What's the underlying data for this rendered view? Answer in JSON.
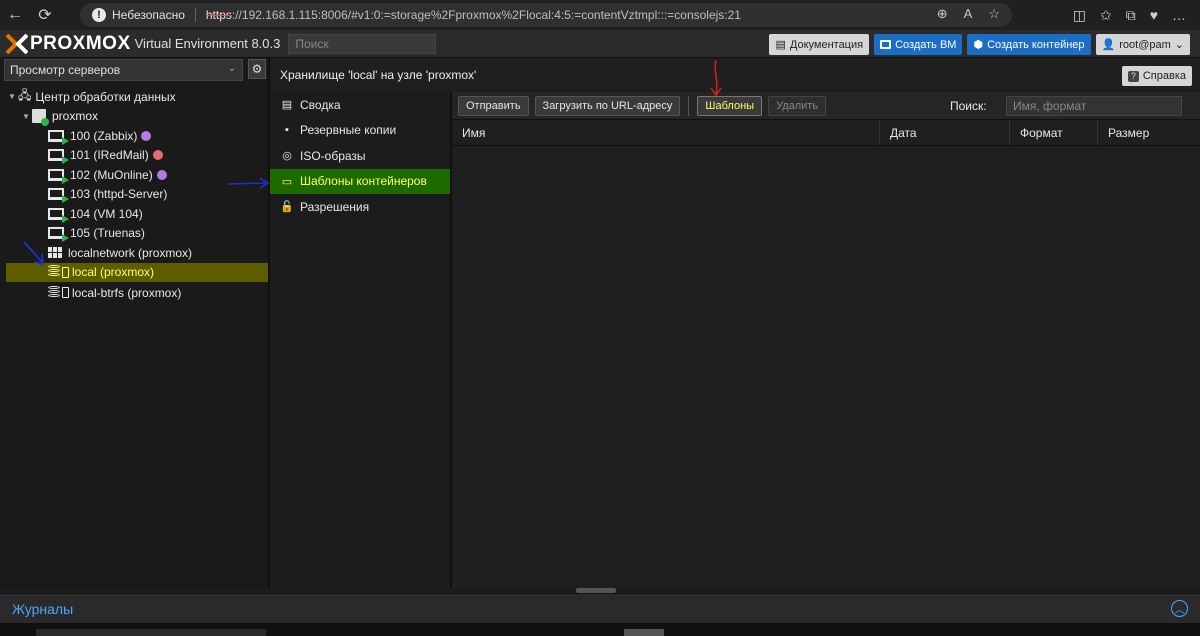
{
  "browser": {
    "insecure_label": "Небезопасно",
    "url_scheme": "https",
    "url_rest": "://192.168.1.115:8006/#v1:0:=storage%2Fproxmox%2Flocal:4:5:=contentVztmpl:::=consolejs:21"
  },
  "header": {
    "logo_text": "PROXMOX",
    "version": "Virtual Environment 8.0.3",
    "search_placeholder": "Поиск",
    "doc_button": "Документация",
    "create_vm_button": "Создать ВМ",
    "create_ct_button": "Создать контейнер",
    "user_button": "root@pam"
  },
  "left": {
    "view_select": "Просмотр серверов",
    "tree": {
      "datacenter": "Центр обработки данных",
      "node": "proxmox",
      "vms": [
        {
          "label": "100 (Zabbix)",
          "tag_color": "#b57ae0"
        },
        {
          "label": "101 (IRedMail)",
          "tag_color": "#e07070"
        },
        {
          "label": "102 (MuOnline)",
          "tag_color": "#b57ae0"
        },
        {
          "label": "103 (httpd-Server)",
          "tag_color": ""
        },
        {
          "label": "104 (VM 104)",
          "tag_color": ""
        },
        {
          "label": "105 (Truenas)",
          "tag_color": ""
        }
      ],
      "network": "localnetwork (proxmox)",
      "storage_local": "local (proxmox)",
      "storage_btrfs": "local-btrfs (proxmox)"
    }
  },
  "content": {
    "title": "Хранилище 'local' на узле 'proxmox'",
    "help_button": "Справка",
    "menu": [
      {
        "label": "Сводка",
        "icon": "book-icon"
      },
      {
        "label": "Резервные копии",
        "icon": "floppy-icon"
      },
      {
        "label": "ISO-образы",
        "icon": "disc-icon"
      },
      {
        "label": "Шаблоны контейнеров",
        "icon": "folder-icon"
      },
      {
        "label": "Разрешения",
        "icon": "unlock-icon"
      }
    ],
    "toolbar": {
      "upload": "Отправить",
      "download_url": "Загрузить по URL-адресу",
      "templates": "Шаблоны",
      "remove": "Удалить",
      "search_label": "Поиск:",
      "search_placeholder": "Имя, формат"
    },
    "columns": [
      "Имя",
      "Дата",
      "Формат",
      "Размер"
    ]
  },
  "footer": {
    "logs": "Журналы"
  },
  "colors": {
    "selected_tree_bg": "#5d5d00",
    "active_menu_bg": "#1d6b00",
    "accent_yellow": "#ffff66",
    "primary_blue": "#1c6ec4"
  }
}
